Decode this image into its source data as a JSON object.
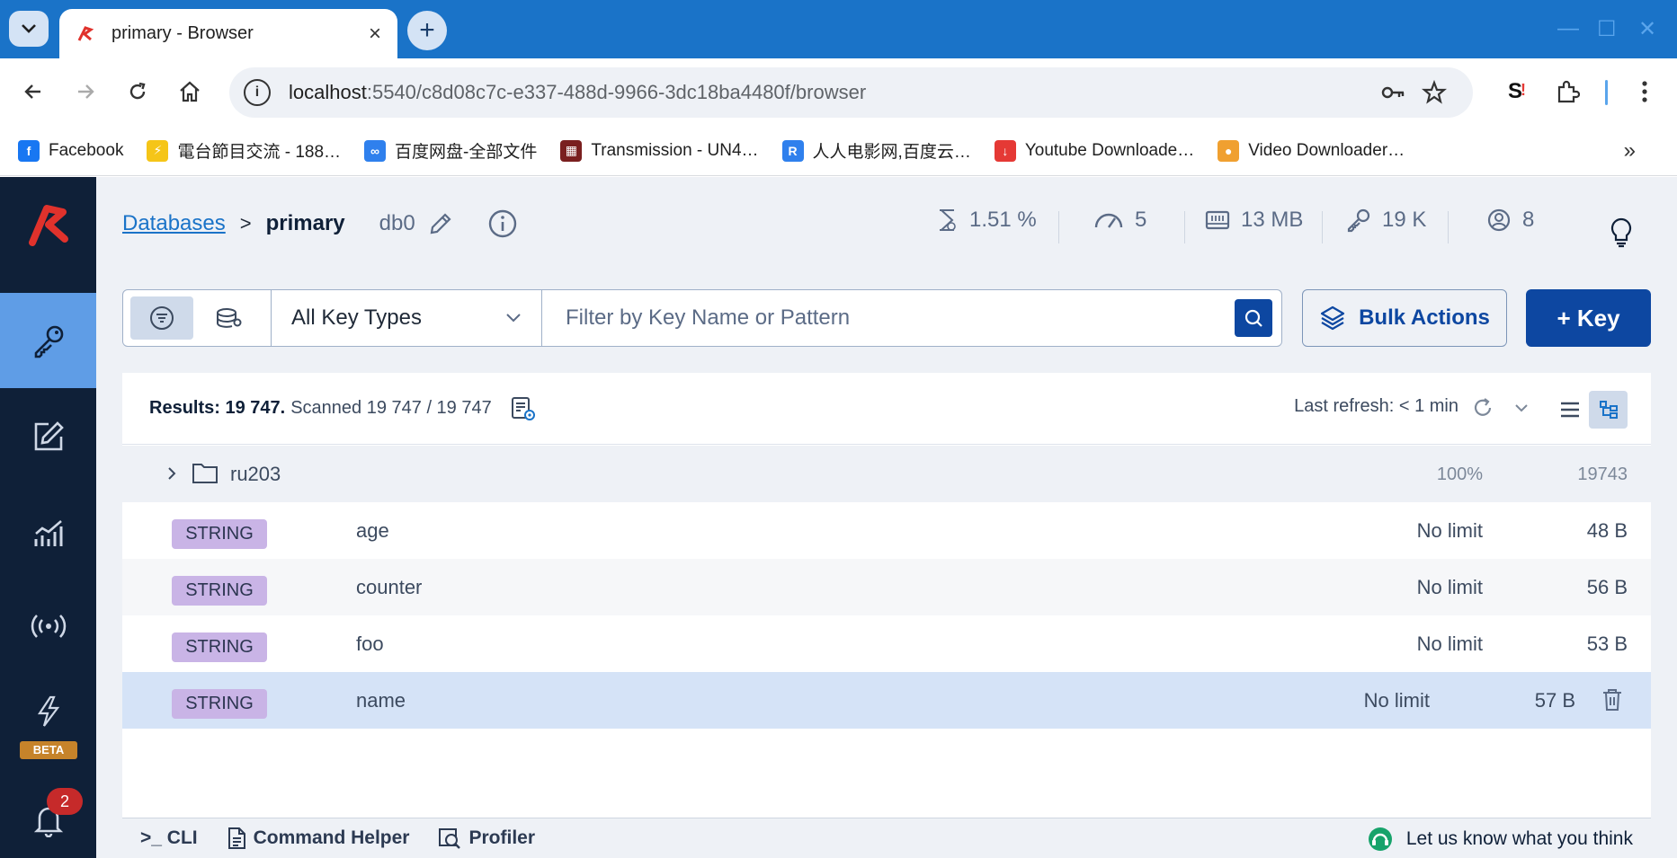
{
  "browser": {
    "tab_title": "primary - Browser",
    "tab_close": "×",
    "new_tab": "+",
    "url_host": "localhost",
    "url_rest": ":5540/c8d08c7c-e337-488d-9966-3dc18ba4480f/browser",
    "bookmarks": [
      {
        "label": "Facebook",
        "color": "#1877f2",
        "glyph": "f"
      },
      {
        "label": "電台節目交流 - 188…",
        "color": "#f5c518",
        "glyph": "⚡"
      },
      {
        "label": "百度网盘-全部文件",
        "color": "#2f80ed",
        "glyph": "∞"
      },
      {
        "label": "Transmission - UN4…",
        "color": "#7a1f1f",
        "glyph": "▦"
      },
      {
        "label": "人人电影网,百度云…",
        "color": "#2f80ed",
        "glyph": "R"
      },
      {
        "label": "Youtube Downloade…",
        "color": "#e53935",
        "glyph": "↓"
      },
      {
        "label": "Video Downloader…",
        "color": "#f0a030",
        "glyph": "●"
      }
    ],
    "more": "»"
  },
  "sidebar": {
    "beta_label": "BETA",
    "notification_count": "2"
  },
  "header": {
    "crumb_databases": "Databases",
    "crumb_sep": ">",
    "crumb_current": "primary",
    "db_name": "db0",
    "stats": {
      "cpu": "1.51 %",
      "ops": "5",
      "memory": "13 MB",
      "keys": "19 K",
      "clients": "8"
    }
  },
  "filter": {
    "key_type": "All Key Types",
    "search_placeholder": "Filter by Key Name or Pattern",
    "bulk_actions": "Bulk Actions",
    "add_key": "+ Key"
  },
  "results": {
    "summary_bold": "Results: 19 747.",
    "summary_rest": "Scanned 19 747 / 19 747",
    "last_refresh": "Last refresh: < 1 min",
    "folder": {
      "name": "ru203",
      "percent": "100%",
      "count": "19743"
    },
    "rows": [
      {
        "type": "STRING",
        "name": "age",
        "ttl": "No limit",
        "size": "48 B"
      },
      {
        "type": "STRING",
        "name": "counter",
        "ttl": "No limit",
        "size": "56 B"
      },
      {
        "type": "STRING",
        "name": "foo",
        "ttl": "No limit",
        "size": "53 B"
      },
      {
        "type": "STRING",
        "name": "name",
        "ttl": "No limit",
        "size": "57 B"
      }
    ]
  },
  "bottom": {
    "cli": ">_ CLI",
    "command_helper": "Command Helper",
    "profiler": "Profiler",
    "feedback": "Let us know what you think"
  },
  "colors": {
    "sidebar_bg": "#0f2038",
    "accent": "#0d47a1",
    "badge_string": "#c9b4e6",
    "selected_row": "#d5e3f7"
  }
}
